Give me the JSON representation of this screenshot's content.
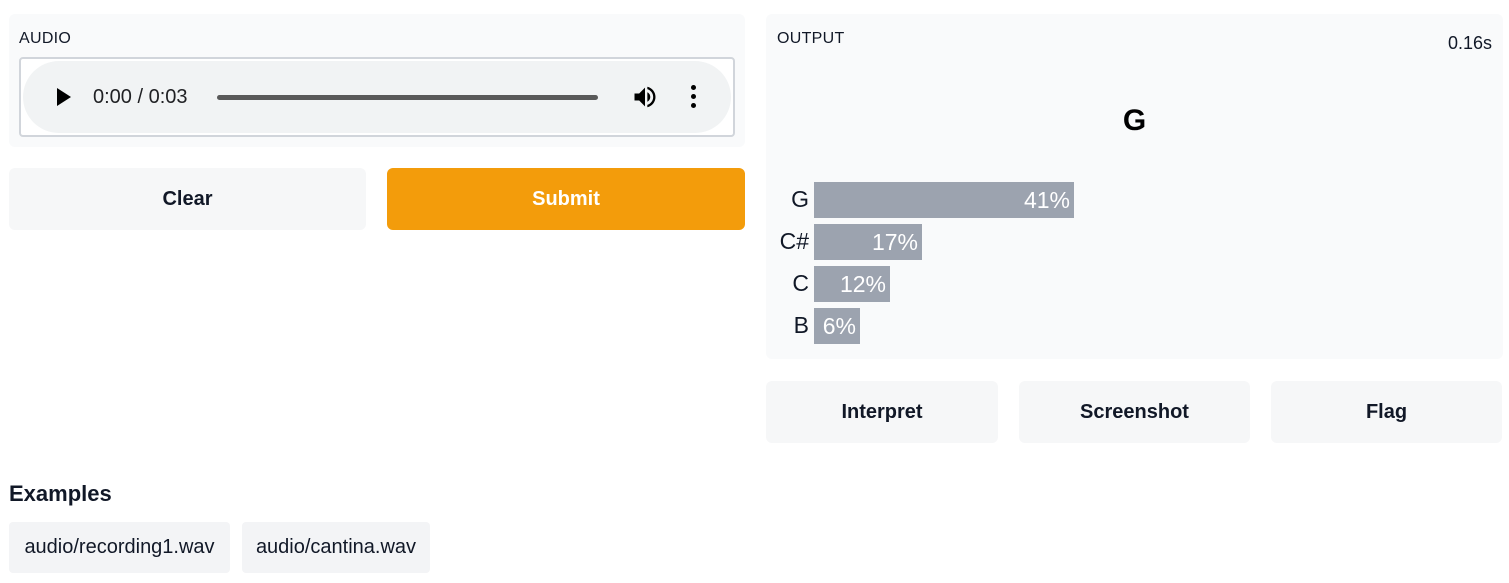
{
  "audio": {
    "label": "AUDIO",
    "time": "0:00 / 0:03"
  },
  "buttons": {
    "clear": "Clear",
    "submit": "Submit",
    "interpret": "Interpret",
    "screenshot": "Screenshot",
    "flag": "Flag"
  },
  "output": {
    "label": "OUTPUT",
    "timing": "0.16s",
    "top_label": "G",
    "confidences": [
      {
        "label": "G",
        "value": 0.41,
        "text": "41%"
      },
      {
        "label": "C#",
        "value": 0.17,
        "text": "17%"
      },
      {
        "label": "C",
        "value": 0.12,
        "text": "12%"
      },
      {
        "label": "B",
        "value": 0.06,
        "text": "6%"
      }
    ]
  },
  "examples": {
    "title": "Examples",
    "items": [
      "audio/recording1.wav",
      "audio/cantina.wav"
    ]
  },
  "colors": {
    "primary": "#f39c0b",
    "bar": "#9ca3af",
    "panel": "#f9fafb"
  }
}
